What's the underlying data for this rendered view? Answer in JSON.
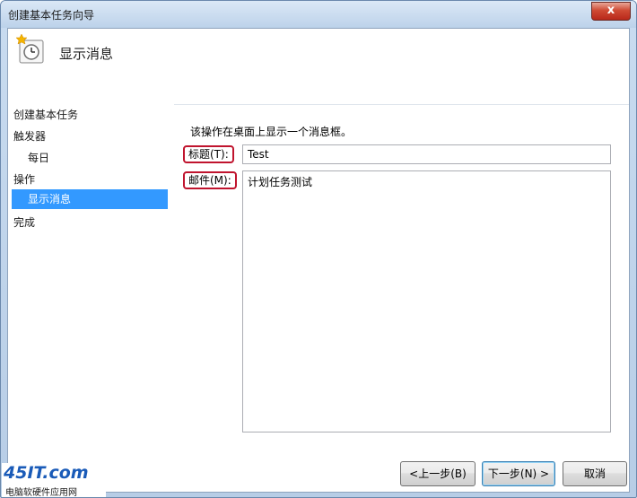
{
  "window": {
    "title": "创建基本任务向导",
    "close_glyph": "x"
  },
  "header": {
    "title": "显示消息",
    "icon": "task-clock-icon"
  },
  "steps": [
    {
      "label": "创建基本任务"
    },
    {
      "label": "触发器"
    },
    {
      "label": "每日"
    },
    {
      "label": "操作"
    },
    {
      "label": "显示消息"
    },
    {
      "label": "完成"
    }
  ],
  "form": {
    "description": "该操作在桌面上显示一个消息框。",
    "title_label": "标题(T):",
    "title_value": "Test",
    "message_label": "邮件(M):",
    "message_value": "计划任务测试"
  },
  "buttons": {
    "back": "<上一步(B)",
    "next": "下一步(N) >",
    "cancel": "取消"
  },
  "watermark": {
    "logo": "45IT.com",
    "subtitle": "电脑软硬件应用网"
  }
}
